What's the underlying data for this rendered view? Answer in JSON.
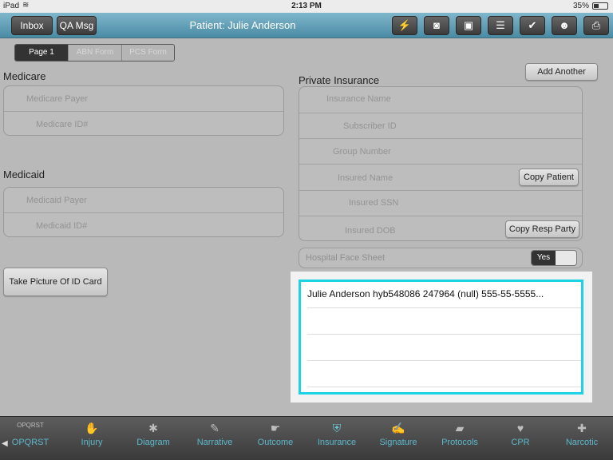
{
  "status": {
    "device": "iPad",
    "time": "2:13 PM",
    "battery": "35%",
    "battery_level": 0.35
  },
  "header": {
    "inbox_label": "Inbox",
    "qa_label": "QA Msg",
    "title": "Patient: Julie Anderson",
    "icons": [
      "lightning-icon",
      "camera-icon",
      "gallery-icon",
      "clipboard-icon",
      "check-icon",
      "people-icon",
      "printer-icon"
    ]
  },
  "pages": {
    "page1": "Page 1",
    "abn": "ABN Form",
    "pcs": "PCS Form",
    "selected": "Page 1"
  },
  "medicare": {
    "title": "Medicare",
    "payer_placeholder": "Medicare Payer",
    "id_placeholder": "Medicare ID#"
  },
  "medicaid": {
    "title": "Medicaid",
    "payer_placeholder": "Medicaid Payer",
    "id_placeholder": "Medicaid ID#"
  },
  "private": {
    "title": "Private Insurance",
    "add_another": "Add Another",
    "insurance_name": "Insurance Name",
    "subscriber_id": "Subscriber ID",
    "group_number": "Group Number",
    "insured_name": "Insured Name",
    "copy_patient": "Copy Patient",
    "insured_ssn": "Insured SSN",
    "insured_dob": "Insured DOB",
    "copy_resp": "Copy Resp Party"
  },
  "facesheet": {
    "label": "Hospital Face Sheet",
    "toggle_value": "Yes"
  },
  "take_picture": "Take Picture Of ID Card",
  "popup": {
    "rows": [
      "Julie Anderson  hyb548086 247964 (null) 555-55-5555...",
      "",
      "",
      ""
    ]
  },
  "tabs": [
    {
      "label": "OPQRST",
      "icon": "OPQRST"
    },
    {
      "label": "Injury",
      "icon": "✋"
    },
    {
      "label": "Diagram",
      "icon": "✱"
    },
    {
      "label": "Narrative",
      "icon": "✎"
    },
    {
      "label": "Outcome",
      "icon": "☛"
    },
    {
      "label": "Insurance",
      "icon": "⛨"
    },
    {
      "label": "Signature",
      "icon": "✍"
    },
    {
      "label": "Protocols",
      "icon": "▰"
    },
    {
      "label": "CPR",
      "icon": "♥"
    },
    {
      "label": "Narcotic",
      "icon": "✚"
    }
  ],
  "colors": {
    "accent": "#5cb8cc",
    "header": "#5f9fb6",
    "highlight": "#1cd3e3"
  }
}
